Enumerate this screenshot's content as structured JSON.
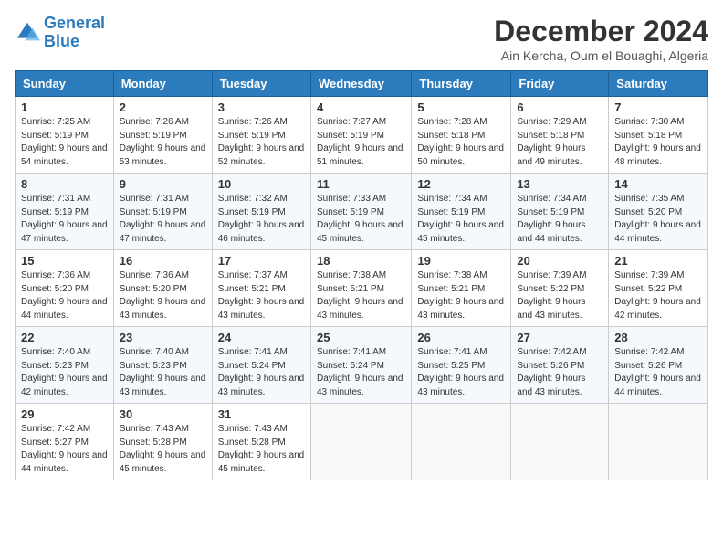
{
  "header": {
    "logo_line1": "General",
    "logo_line2": "Blue",
    "month": "December 2024",
    "location": "Ain Kercha, Oum el Bouaghi, Algeria"
  },
  "days_of_week": [
    "Sunday",
    "Monday",
    "Tuesday",
    "Wednesday",
    "Thursday",
    "Friday",
    "Saturday"
  ],
  "weeks": [
    [
      {
        "day": "1",
        "sunrise": "7:25 AM",
        "sunset": "5:19 PM",
        "daylight": "9 hours and 54 minutes."
      },
      {
        "day": "2",
        "sunrise": "7:26 AM",
        "sunset": "5:19 PM",
        "daylight": "9 hours and 53 minutes."
      },
      {
        "day": "3",
        "sunrise": "7:26 AM",
        "sunset": "5:19 PM",
        "daylight": "9 hours and 52 minutes."
      },
      {
        "day": "4",
        "sunrise": "7:27 AM",
        "sunset": "5:19 PM",
        "daylight": "9 hours and 51 minutes."
      },
      {
        "day": "5",
        "sunrise": "7:28 AM",
        "sunset": "5:18 PM",
        "daylight": "9 hours and 50 minutes."
      },
      {
        "day": "6",
        "sunrise": "7:29 AM",
        "sunset": "5:18 PM",
        "daylight": "9 hours and 49 minutes."
      },
      {
        "day": "7",
        "sunrise": "7:30 AM",
        "sunset": "5:18 PM",
        "daylight": "9 hours and 48 minutes."
      }
    ],
    [
      {
        "day": "8",
        "sunrise": "7:31 AM",
        "sunset": "5:19 PM",
        "daylight": "9 hours and 47 minutes."
      },
      {
        "day": "9",
        "sunrise": "7:31 AM",
        "sunset": "5:19 PM",
        "daylight": "9 hours and 47 minutes."
      },
      {
        "day": "10",
        "sunrise": "7:32 AM",
        "sunset": "5:19 PM",
        "daylight": "9 hours and 46 minutes."
      },
      {
        "day": "11",
        "sunrise": "7:33 AM",
        "sunset": "5:19 PM",
        "daylight": "9 hours and 45 minutes."
      },
      {
        "day": "12",
        "sunrise": "7:34 AM",
        "sunset": "5:19 PM",
        "daylight": "9 hours and 45 minutes."
      },
      {
        "day": "13",
        "sunrise": "7:34 AM",
        "sunset": "5:19 PM",
        "daylight": "9 hours and 44 minutes."
      },
      {
        "day": "14",
        "sunrise": "7:35 AM",
        "sunset": "5:20 PM",
        "daylight": "9 hours and 44 minutes."
      }
    ],
    [
      {
        "day": "15",
        "sunrise": "7:36 AM",
        "sunset": "5:20 PM",
        "daylight": "9 hours and 44 minutes."
      },
      {
        "day": "16",
        "sunrise": "7:36 AM",
        "sunset": "5:20 PM",
        "daylight": "9 hours and 43 minutes."
      },
      {
        "day": "17",
        "sunrise": "7:37 AM",
        "sunset": "5:21 PM",
        "daylight": "9 hours and 43 minutes."
      },
      {
        "day": "18",
        "sunrise": "7:38 AM",
        "sunset": "5:21 PM",
        "daylight": "9 hours and 43 minutes."
      },
      {
        "day": "19",
        "sunrise": "7:38 AM",
        "sunset": "5:21 PM",
        "daylight": "9 hours and 43 minutes."
      },
      {
        "day": "20",
        "sunrise": "7:39 AM",
        "sunset": "5:22 PM",
        "daylight": "9 hours and 43 minutes."
      },
      {
        "day": "21",
        "sunrise": "7:39 AM",
        "sunset": "5:22 PM",
        "daylight": "9 hours and 42 minutes."
      }
    ],
    [
      {
        "day": "22",
        "sunrise": "7:40 AM",
        "sunset": "5:23 PM",
        "daylight": "9 hours and 42 minutes."
      },
      {
        "day": "23",
        "sunrise": "7:40 AM",
        "sunset": "5:23 PM",
        "daylight": "9 hours and 43 minutes."
      },
      {
        "day": "24",
        "sunrise": "7:41 AM",
        "sunset": "5:24 PM",
        "daylight": "9 hours and 43 minutes."
      },
      {
        "day": "25",
        "sunrise": "7:41 AM",
        "sunset": "5:24 PM",
        "daylight": "9 hours and 43 minutes."
      },
      {
        "day": "26",
        "sunrise": "7:41 AM",
        "sunset": "5:25 PM",
        "daylight": "9 hours and 43 minutes."
      },
      {
        "day": "27",
        "sunrise": "7:42 AM",
        "sunset": "5:26 PM",
        "daylight": "9 hours and 43 minutes."
      },
      {
        "day": "28",
        "sunrise": "7:42 AM",
        "sunset": "5:26 PM",
        "daylight": "9 hours and 44 minutes."
      }
    ],
    [
      {
        "day": "29",
        "sunrise": "7:42 AM",
        "sunset": "5:27 PM",
        "daylight": "9 hours and 44 minutes."
      },
      {
        "day": "30",
        "sunrise": "7:43 AM",
        "sunset": "5:28 PM",
        "daylight": "9 hours and 45 minutes."
      },
      {
        "day": "31",
        "sunrise": "7:43 AM",
        "sunset": "5:28 PM",
        "daylight": "9 hours and 45 minutes."
      },
      null,
      null,
      null,
      null
    ]
  ]
}
